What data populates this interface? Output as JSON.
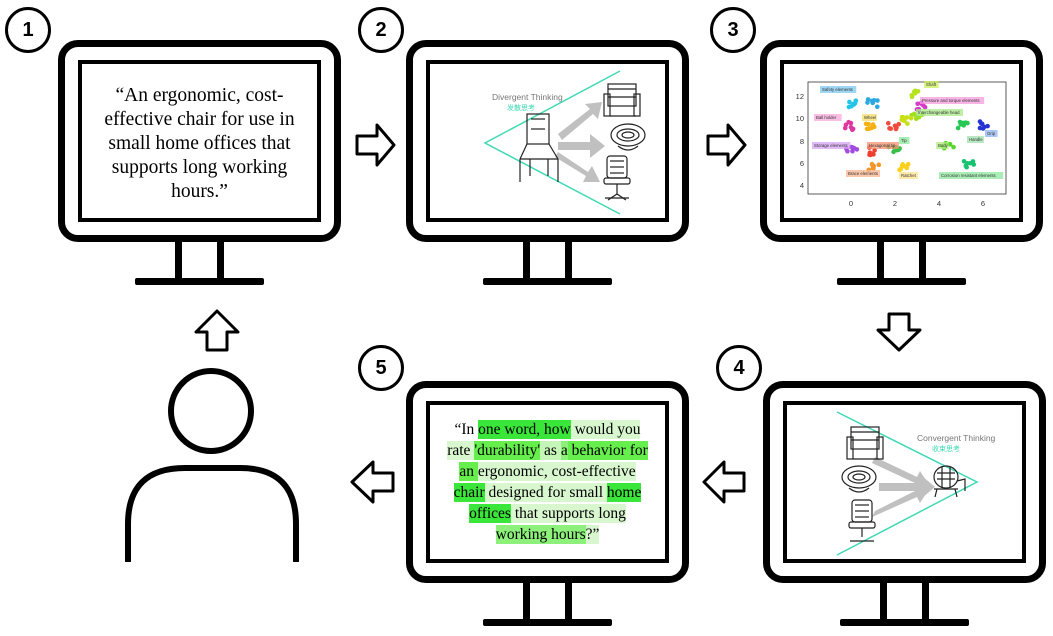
{
  "steps": {
    "s1": {
      "number": "1"
    },
    "s2": {
      "number": "2",
      "title": "Divergent Thinking",
      "subtitle": "发散思考"
    },
    "s3": {
      "number": "3"
    },
    "s4": {
      "number": "4",
      "title": "Convergent Thinking",
      "subtitle": "收束思考"
    },
    "s5": {
      "number": "5"
    }
  },
  "prompt": {
    "text": "“An ergonomic, cost-effective chair for use in small home offices that supports long working hours.”"
  },
  "rephrased": {
    "tokens": [
      {
        "t": "“In ",
        "c": "#ffffff"
      },
      {
        "t": "one word, how",
        "c": "#39e639"
      },
      {
        "t": " would you rate ",
        "c": "#d8f7cf"
      },
      {
        "t": "'durability'",
        "c": "#66ee4d"
      },
      {
        "t": " as ",
        "c": "#c6f5b8"
      },
      {
        "t": "a",
        "c": "#8cf07a"
      },
      {
        "t": " behavior for an ",
        "c": "#66ee4d"
      },
      {
        "t": "ergonomic, cost-effective",
        "c": "#d8f7cf"
      },
      {
        "t": " chair",
        "c": "#39e639"
      },
      {
        "t": " designed for small ",
        "c": "#d8f7cf"
      },
      {
        "t": "home offices",
        "c": "#39e639"
      },
      {
        "t": " that supports long ",
        "c": "#d8f7cf"
      },
      {
        "t": "working hours",
        "c": "#8cf07a"
      },
      {
        "t": "?”",
        "c": "#d8f7cf"
      }
    ]
  },
  "cluster_plot": {
    "yticks": [
      "12",
      "10",
      "8",
      "6",
      "4"
    ],
    "xticks": [
      "0",
      "2",
      "4",
      "6"
    ],
    "labels": [
      {
        "text": "Safety elements",
        "color": "#7fc8f0"
      },
      {
        "text": "Shaft",
        "color": "#c9ef5a"
      },
      {
        "text": "Pressure and torque elements",
        "color": "#f49bdc"
      },
      {
        "text": "Interchangeable head",
        "color": "#a9ea8a"
      },
      {
        "text": "Ball holder",
        "color": "#f8a7d9"
      },
      {
        "text": "Wheel",
        "color": "#f6de6a"
      },
      {
        "text": "Grip",
        "color": "#8fb6f0"
      },
      {
        "text": "Storage elements",
        "color": "#d7a2f4"
      },
      {
        "text": "Hexagonal tip",
        "color": "#f59172"
      },
      {
        "text": "Tip",
        "color": "#88ea9c"
      },
      {
        "text": "Body",
        "color": "#b6ec84"
      },
      {
        "text": "Handle",
        "color": "#9fe0ae"
      },
      {
        "text": "Brace elements",
        "color": "#f9b58f"
      },
      {
        "text": "Ratchet",
        "color": "#fde18b"
      },
      {
        "text": "Corrosion resistant elements",
        "color": "#8ee79e"
      }
    ]
  },
  "colors": {
    "funnel": "#40d9b4",
    "arrow": "#c0c0c0"
  }
}
